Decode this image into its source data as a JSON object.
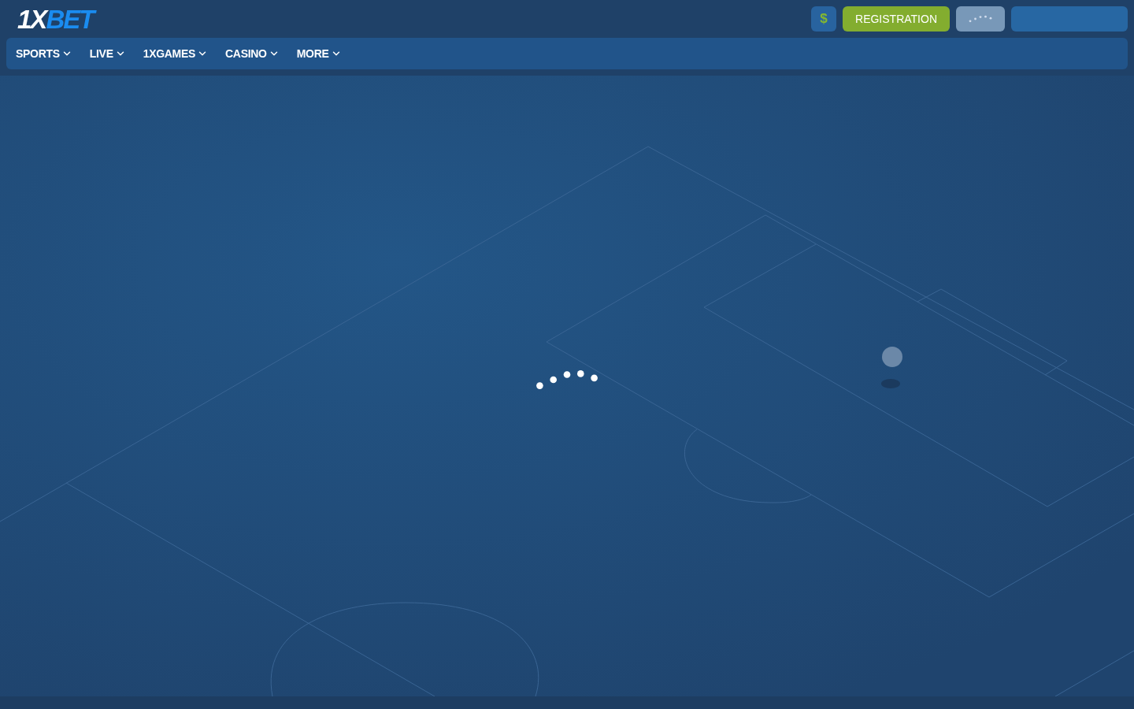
{
  "logo": {
    "lead": "1X",
    "tail": "BET"
  },
  "header": {
    "currency_symbol": "$",
    "register_label": "REGISTRATION"
  },
  "nav": [
    {
      "label": "SPORTS"
    },
    {
      "label": "LIVE"
    },
    {
      "label": "1XGAMES"
    },
    {
      "label": "CASINO"
    },
    {
      "label": "MORE"
    }
  ]
}
